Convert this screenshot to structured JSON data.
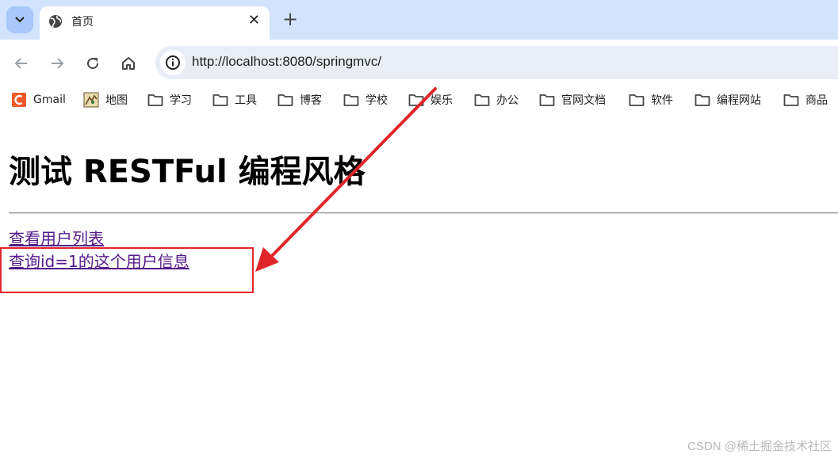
{
  "tab": {
    "title": "首页"
  },
  "address_bar": {
    "url": "http://localhost:8080/springmvc/"
  },
  "bookmarks": [
    {
      "label": "Gmail",
      "icon": "gmail-icon"
    },
    {
      "label": "地图",
      "icon": "map-icon"
    },
    {
      "label": "学习",
      "icon": "folder-icon"
    },
    {
      "label": "工具",
      "icon": "folder-icon"
    },
    {
      "label": "博客",
      "icon": "folder-icon"
    },
    {
      "label": "学校",
      "icon": "folder-icon"
    },
    {
      "label": "娱乐",
      "icon": "folder-icon"
    },
    {
      "label": "办公",
      "icon": "folder-icon"
    },
    {
      "label": "官网文档",
      "icon": "folder-icon"
    },
    {
      "label": "软件",
      "icon": "folder-icon"
    },
    {
      "label": "编程网站",
      "icon": "folder-icon"
    },
    {
      "label": "商品",
      "icon": "folder-icon"
    }
  ],
  "page": {
    "heading": "测试 RESTFul 编程风格",
    "links": [
      {
        "text": "查看用户列表"
      },
      {
        "text": "查询id=1的这个用户信息"
      }
    ]
  },
  "annotation": {
    "color": "#e0262b"
  },
  "watermark": "CSDN @稀土掘金技术社区",
  "colors": {
    "tabstrip": "#d3e3fd",
    "omnibox": "#e9eef6",
    "visited_link": "#551a8b"
  }
}
